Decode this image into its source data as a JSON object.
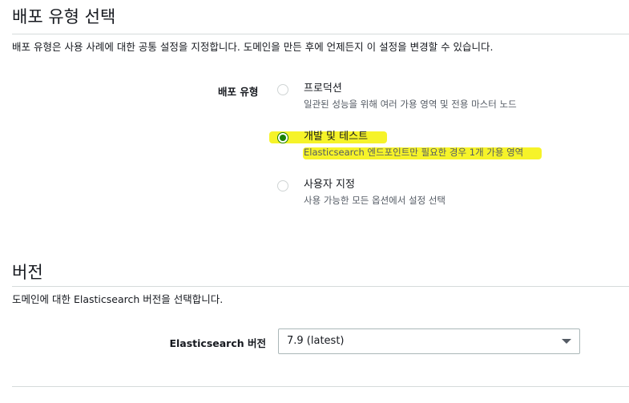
{
  "deployment_section": {
    "title": "배포 유형 선택",
    "description": "배포 유형은 사용 사례에 대한 공통 설정을 지정합니다. 도메인을 만든 후에 언제든지 이 설정을 변경할 수 있습니다.",
    "field_label": "배포 유형",
    "options": [
      {
        "title": "프로덕션",
        "description": "일관된 성능을 위해 여러 가용 영역 및 전용 마스터 노드",
        "selected": false
      },
      {
        "title": "개발 및 테스트",
        "description": "Elasticsearch 엔드포인트만 필요한 경우 1개 가용 영역",
        "selected": true
      },
      {
        "title": "사용자 지정",
        "description": "사용 가능한 모든 옵션에서 설정 선택",
        "selected": false
      }
    ]
  },
  "version_section": {
    "title": "버전",
    "description": "도메인에 대한 Elasticsearch 버전을 선택합니다.",
    "field_label": "Elasticsearch 버전",
    "selected_version": "7.9 (latest)"
  },
  "colors": {
    "radio_selected": "#1d8102",
    "highlight": "#f5f21d",
    "divider": "#d5dbdb"
  },
  "icons": {
    "select_caret": "caret-down-icon"
  }
}
